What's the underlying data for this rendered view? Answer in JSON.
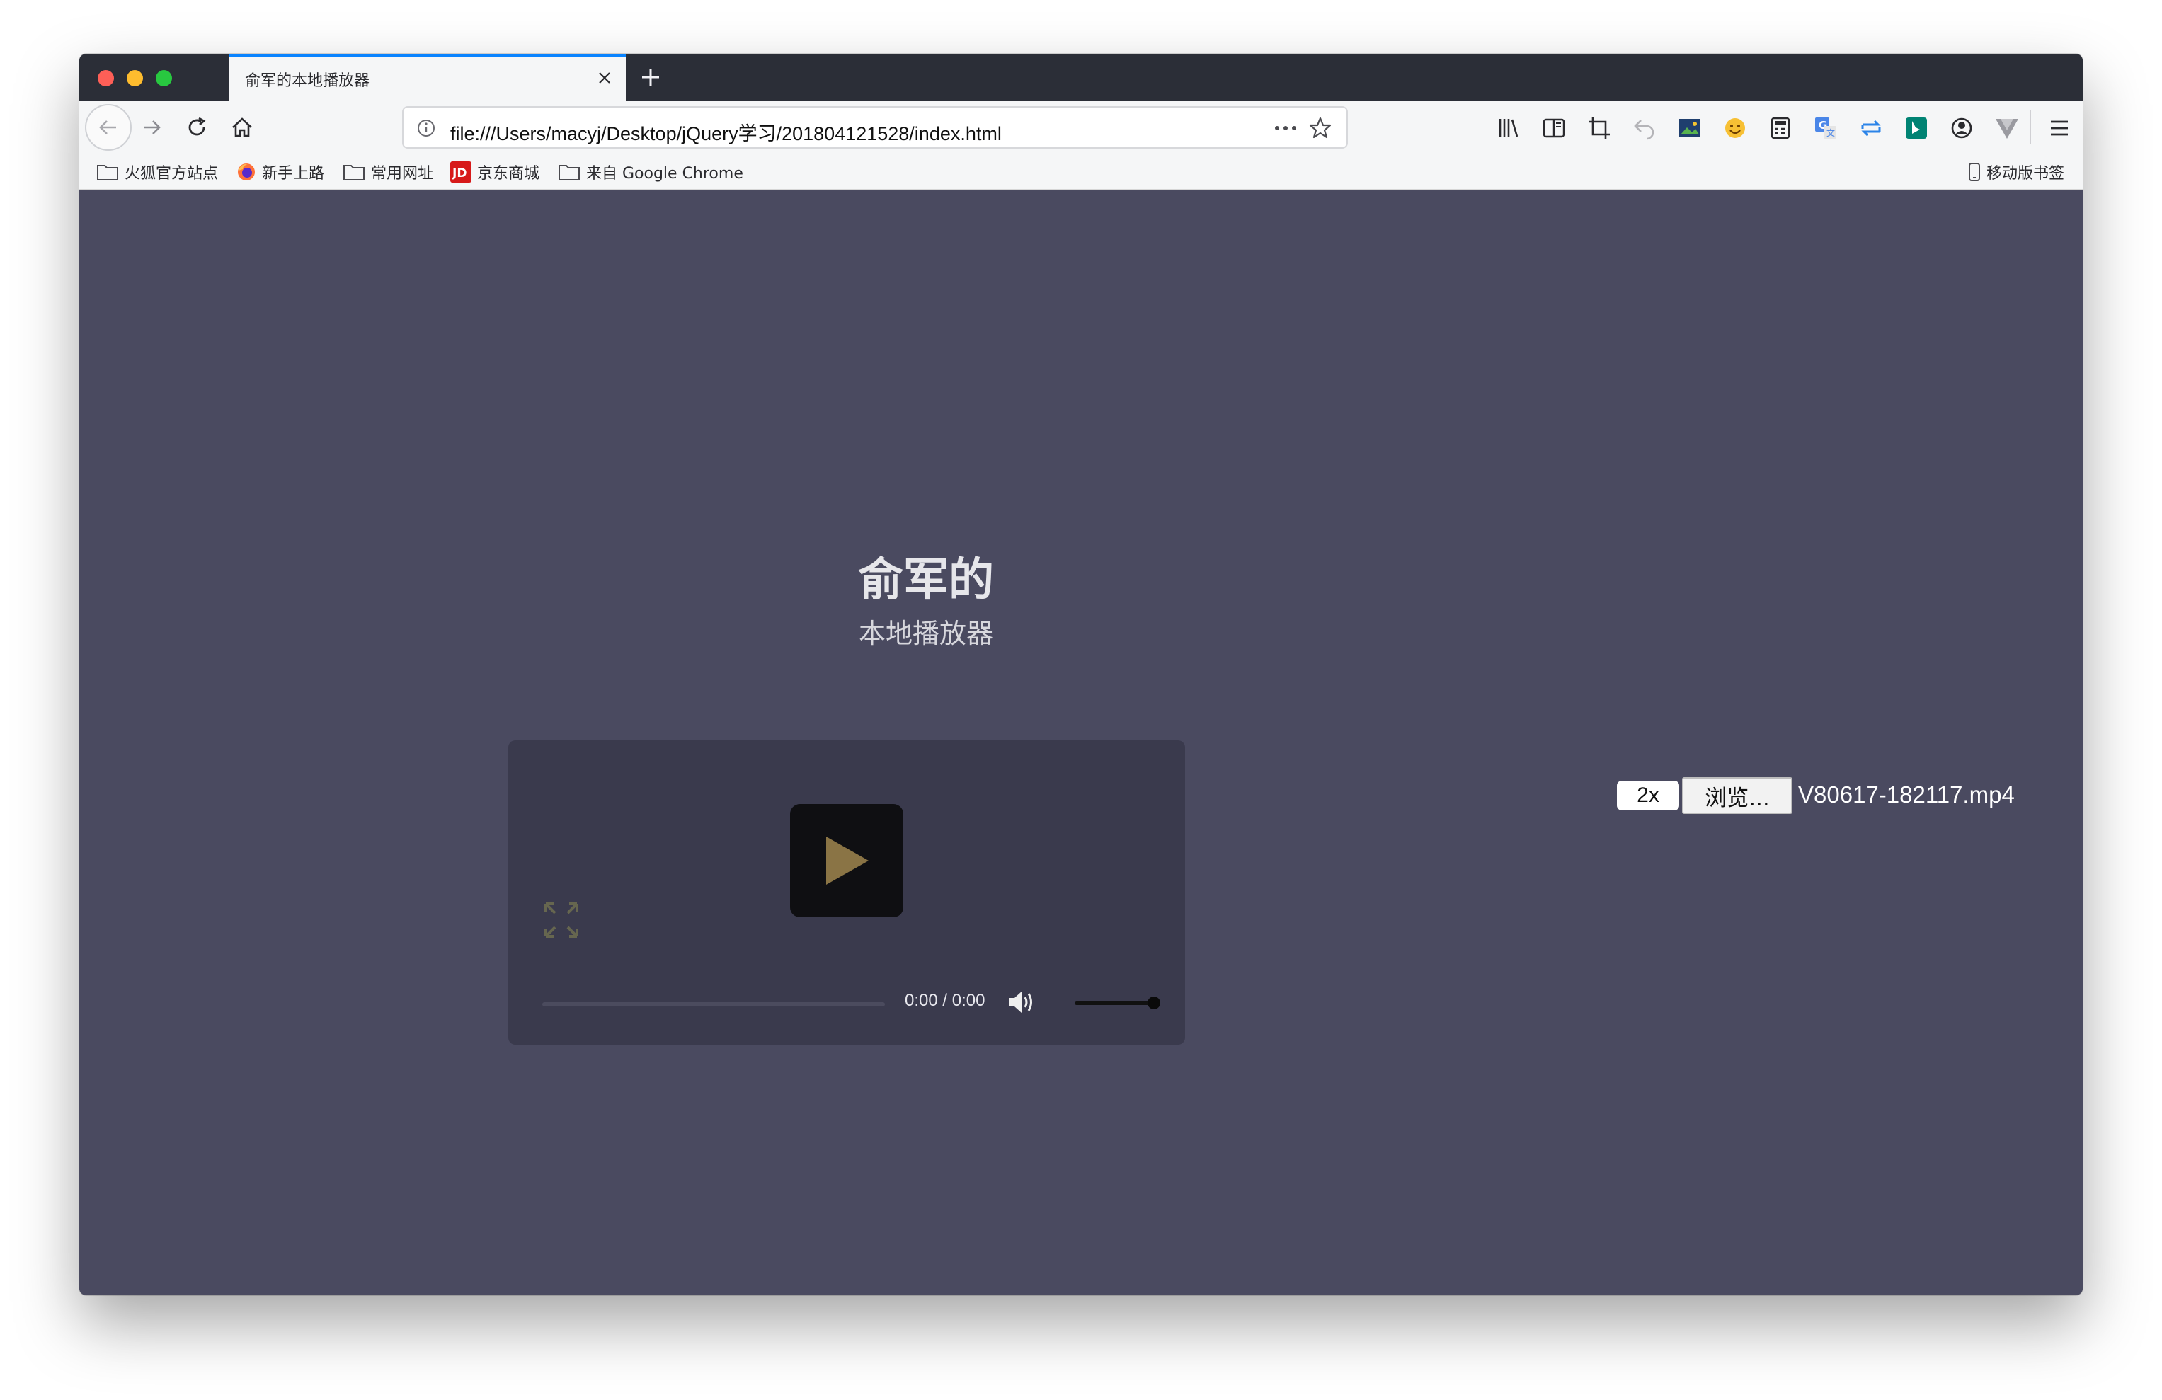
{
  "browser": {
    "tab_title": "俞军的本地播放器",
    "url": "file:///Users/macyj/Desktop/jQuery学习/201804121528/index.html"
  },
  "bookmarks": [
    {
      "label": "火狐官方站点",
      "icon": "folder-icon"
    },
    {
      "label": "新手上路",
      "icon": "firefox-icon"
    },
    {
      "label": "常用网址",
      "icon": "folder-icon"
    },
    {
      "label": "京东商城",
      "icon": "jd-icon"
    },
    {
      "label": "来自 Google Chrome",
      "icon": "folder-icon"
    }
  ],
  "mobile_bookmarks": "移动版书签",
  "page": {
    "heading": "俞军的",
    "subheading": "本地播放器"
  },
  "player": {
    "time": "0:00 / 0:00",
    "progress": 0,
    "volume": 1.0,
    "accent_color": "#c8a850"
  },
  "controls": {
    "speed_label": "2x",
    "browse_label": "浏览...",
    "filename": "V80617-182117.mp4"
  }
}
